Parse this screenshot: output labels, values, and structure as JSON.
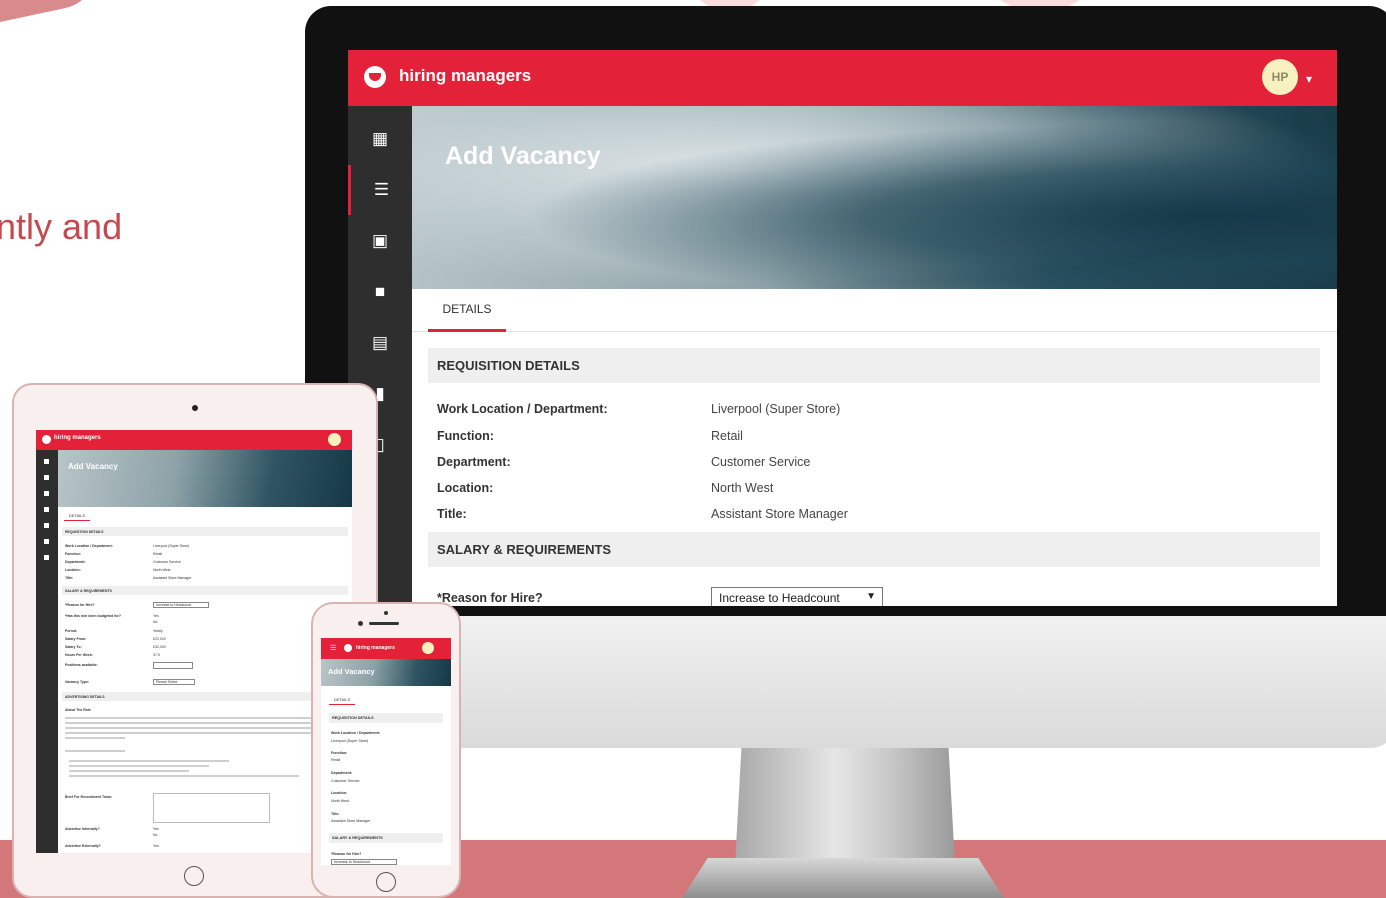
{
  "tagline": "ntly and",
  "app": {
    "name": "hiring managers",
    "user_initials": "HP"
  },
  "sidebar_icons": [
    "dashboard-icon",
    "list-icon",
    "badge-icon",
    "briefcase-icon",
    "calendar-icon",
    "document-icon",
    "book-icon"
  ],
  "page": {
    "title": "Add Vacancy",
    "tab": "DETAILS"
  },
  "requisition": {
    "heading": "REQUISITION DETAILS",
    "fields": [
      {
        "label": "Work Location / Department:",
        "value": "Liverpool (Super Store)"
      },
      {
        "label": "Function:",
        "value": "Retail"
      },
      {
        "label": "Department:",
        "value": "Customer Service"
      },
      {
        "label": "Location:",
        "value": "North West"
      },
      {
        "label": "Title:",
        "value": "Assistant Store Manager"
      }
    ]
  },
  "salary": {
    "heading": "SALARY & REQUIREMENTS",
    "reason_label": "*Reason for Hire?",
    "reason_value": "Increase to Headcount"
  },
  "tablet": {
    "budget_label": "*Has this role been budgeted for?",
    "period_label": "Period:",
    "period_value": "Yearly",
    "salary_from_label": "Salary From:",
    "salary_from_value": "£22,000",
    "salary_to_label": "Salary To:",
    "salary_to_value": "£32,000",
    "hours_label": "Hours Per Week:",
    "hours_value": "37.5",
    "positions_label": "Positions available:",
    "vacancy_type_label": "Vacancy Type:",
    "vacancy_type_value": "Please Select",
    "advertising_heading": "ADVERTISING DETAILS",
    "about_label": "About The Role",
    "brief_label": "Brief For Recruitment Team:",
    "adv_internal_label": "Advertise Internally?",
    "adv_external_label": "Advertise Externally?",
    "yes": "Yes",
    "no": "No"
  },
  "colors": {
    "brand": "#e3223a",
    "sidebar": "#2e2e2e",
    "section_bg": "#efefef",
    "avatar_bg": "#f8f1bf"
  }
}
